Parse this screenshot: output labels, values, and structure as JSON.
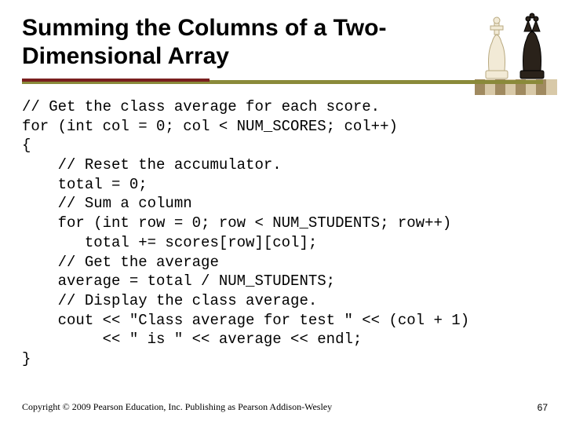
{
  "title": "Summing the Columns of a Two-Dimensional Array",
  "code": "// Get the class average for each score.\nfor (int col = 0; col < NUM_SCORES; col++)\n{\n    // Reset the accumulator.\n    total = 0;\n    // Sum a column\n    for (int row = 0; row < NUM_STUDENTS; row++)\n       total += scores[row][col];\n    // Get the average\n    average = total / NUM_STUDENTS;\n    // Display the class average.\n    cout << \"Class average for test \" << (col + 1)\n         << \" is \" << average << endl;\n}",
  "footer": "Copyright © 2009 Pearson Education, Inc. Publishing as Pearson Addison-Wesley",
  "page_number": "67",
  "chess_icon": "chess-pieces"
}
